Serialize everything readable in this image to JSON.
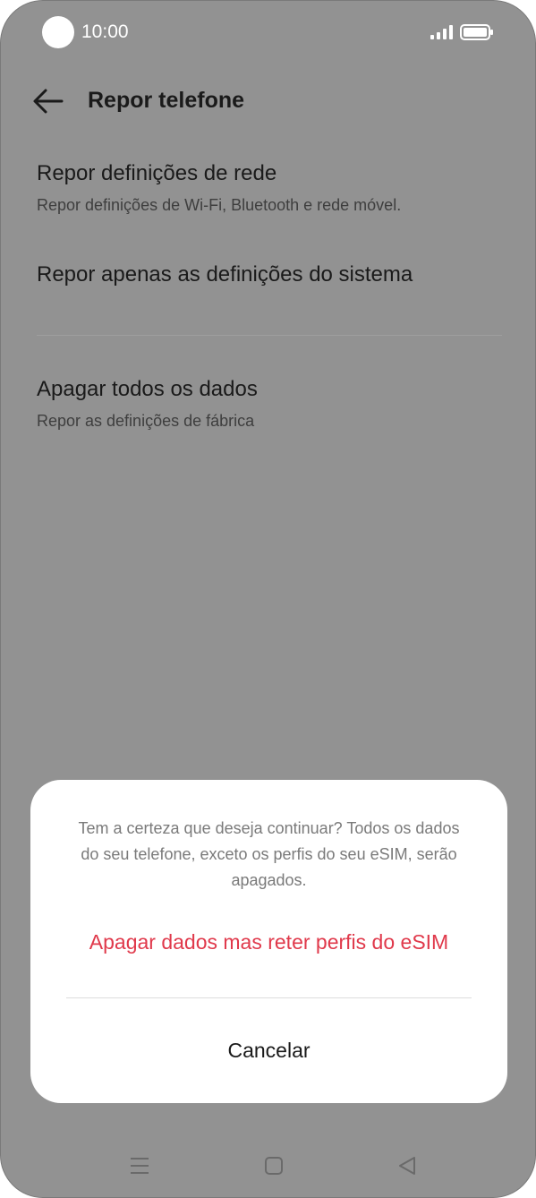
{
  "status_bar": {
    "time": "10:00",
    "icons": [
      "signal-icon",
      "battery-icon"
    ]
  },
  "header": {
    "title": "Repor telefone",
    "back_icon": "arrow-left-icon"
  },
  "list": {
    "items": [
      {
        "title": "Repor definições de rede",
        "subtitle": "Repor definições de Wi-Fi, Bluetooth e rede móvel."
      },
      {
        "title": "Repor apenas as definições do sistema"
      },
      {
        "title": "Apagar todos os dados",
        "subtitle": "Repor as definições de fábrica"
      }
    ]
  },
  "dialog": {
    "message": "Tem a certeza que deseja continuar? Todos os dados do seu telefone, exceto os perfis do seu eSIM, serão apagados.",
    "confirm_label": "Apagar dados mas reter perfis do eSIM",
    "cancel_label": "Cancelar"
  },
  "nav_bar": {
    "icons": [
      "menu-icon",
      "home-icon",
      "back-icon"
    ]
  },
  "colors": {
    "scrim_background": "#929292",
    "dialog_background": "#ffffff",
    "destructive_accent": "#e0394b",
    "primary_text": "#1a1a1a"
  }
}
